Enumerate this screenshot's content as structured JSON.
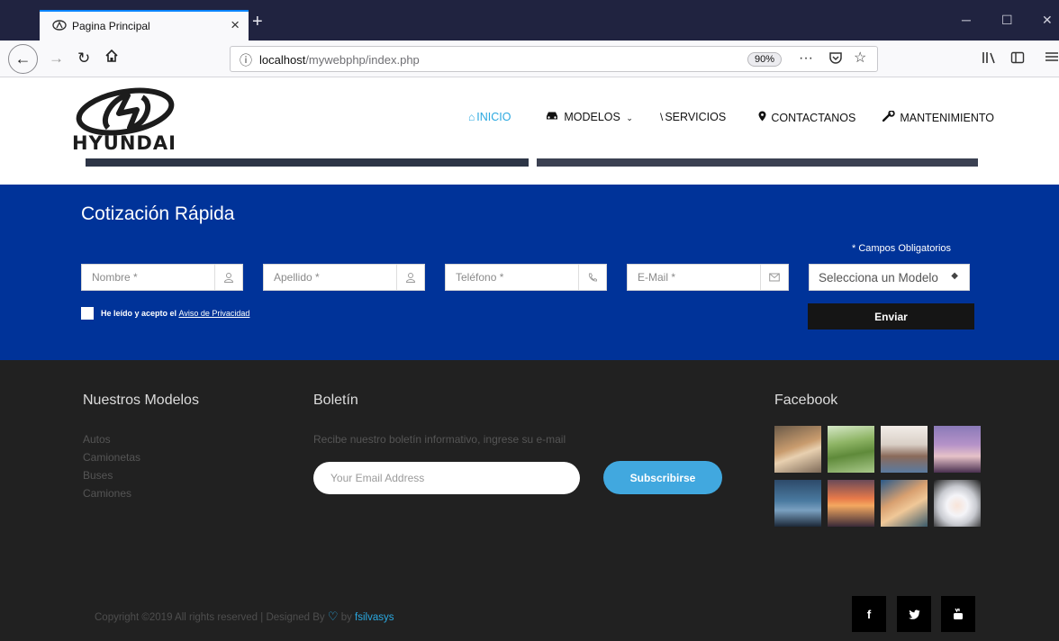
{
  "browser": {
    "tab_title": "Pagina Principal",
    "tab_close": "×",
    "new_tab": "+",
    "url_host": "localhost",
    "url_path": "/mywebphp/index.php",
    "zoom": "90%",
    "icons": [
      "tab-favicon",
      "back-icon",
      "forward-icon",
      "reload-icon",
      "home-icon",
      "info-icon",
      "page-actions-icon",
      "pocket-icon",
      "bookmark-star-icon",
      "library-icon",
      "sidebar-icon",
      "menu-icon",
      "minimize-icon",
      "maximize-icon",
      "close-icon"
    ]
  },
  "header": {
    "logo_text": "HYUNDAI",
    "menu": [
      {
        "label": "INICIO",
        "icon": "home-icon",
        "active": true
      },
      {
        "label": "MODELOS",
        "icon": "car-icon",
        "dropdown": true
      },
      {
        "label": "SERVICIOS",
        "icon": "rss-icon"
      },
      {
        "label": "CONTACTANOS",
        "icon": "map-marker-icon"
      },
      {
        "label": "MANTENIMIENTO",
        "icon": "wrench-icon"
      }
    ]
  },
  "quote": {
    "title": "Cotización Rápida",
    "required_note": "* Campos Obligatorios",
    "fields": [
      {
        "placeholder": "Nombre *",
        "icon": "user-icon"
      },
      {
        "placeholder": "Apellido *",
        "icon": "user-icon"
      },
      {
        "placeholder": "Teléfono *",
        "icon": "phone-icon"
      },
      {
        "placeholder": "E-Mail *",
        "icon": "envelope-icon"
      }
    ],
    "select_value": "Selecciona un Modelo",
    "terms_text": "He leído y acepto el ",
    "terms_link": "Aviso de Privacidad",
    "submit": "Enviar",
    "background": "#003399"
  },
  "footer": {
    "models_title": "Nuestros Modelos",
    "models": [
      "Autos",
      "Camionetas",
      "Buses",
      "Camiones"
    ],
    "newsletter_title": "Boletín",
    "newsletter_text": "Recibe nuestro boletín informativo, ingrese su e-mail",
    "email_placeholder": "Your Email Address",
    "subscribe": "Subscribirse",
    "facebook_title": "Facebook",
    "copyright_prefix": "Copyright ©2019 All rights reserved | Designed By ",
    "copyright_by": " by ",
    "copyright_brand": "fsilvasys",
    "social": [
      {
        "label": "f",
        "icon": "facebook-icon"
      },
      {
        "label": "🐦",
        "icon": "twitter-icon"
      },
      {
        "label": "▣",
        "icon": "youtube-icon"
      }
    ],
    "accent": "#41a8df"
  }
}
